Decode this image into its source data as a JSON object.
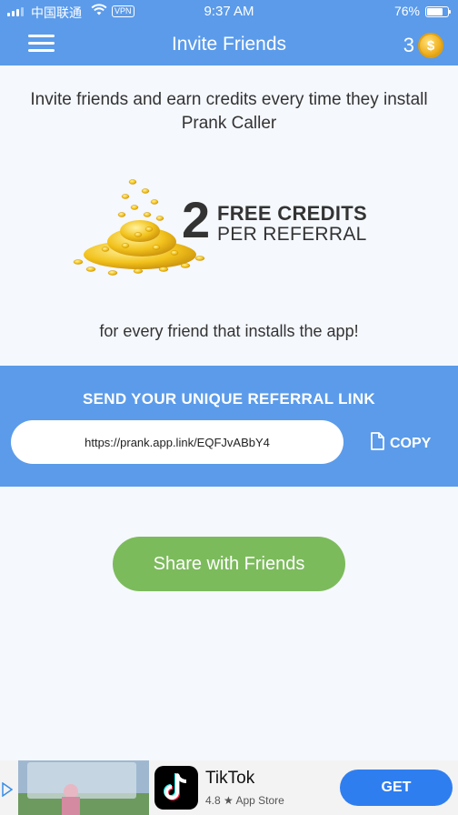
{
  "status_bar": {
    "carrier": "中国联通",
    "vpn": "VPN",
    "time": "9:37 AM",
    "battery_pct": "76%",
    "battery_level": 0.76
  },
  "header": {
    "title": "Invite Friends",
    "credits": "3",
    "coin_symbol": "$",
    "menu_icon": "hamburger-icon",
    "coin_icon": "coin-icon"
  },
  "intro": {
    "text": "Invite friends and earn credits every time they install Prank Caller"
  },
  "promo": {
    "number": "2",
    "line1": "FREE CREDITS",
    "line2": "PER REFERRAL",
    "footer": "for every friend that installs the app!"
  },
  "referral": {
    "heading": "SEND YOUR UNIQUE REFERRAL LINK",
    "link": "https://prank.app.link/EQFJvABbY4",
    "copy_label": "COPY",
    "copy_icon": "copy-icon"
  },
  "share": {
    "label": "Share with Friends"
  },
  "ad": {
    "app_name": "TikTok",
    "rating": "4.8 ★ App Store",
    "cta": "GET"
  },
  "colors": {
    "header_blue": "#5b9bea",
    "share_green": "#7cbb5c",
    "ad_button_blue": "#2f7ef0"
  }
}
